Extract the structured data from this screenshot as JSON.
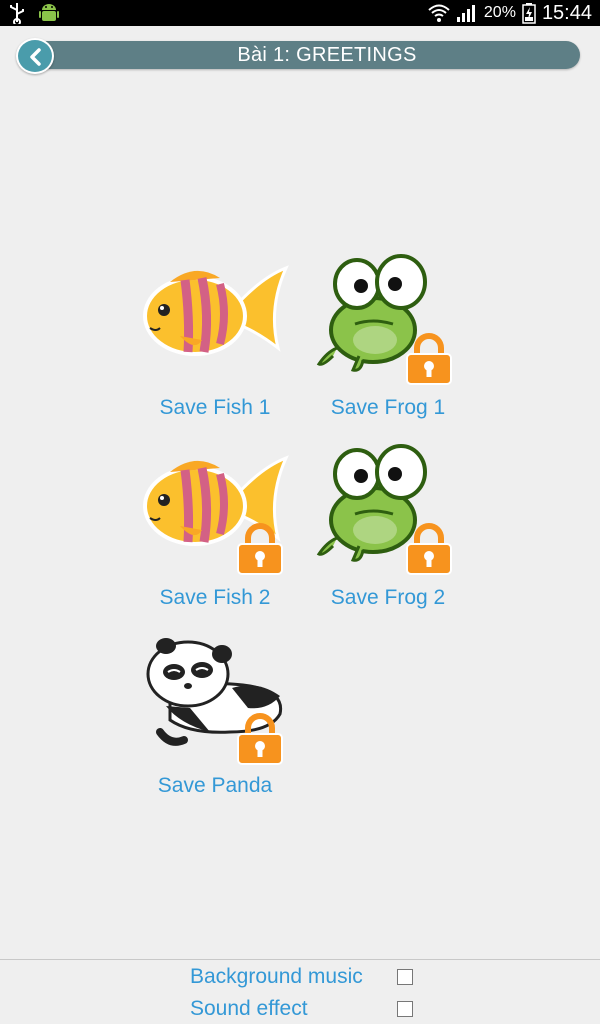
{
  "status_bar": {
    "icons_left": [
      "usb-icon",
      "android-icon"
    ],
    "icons_right": [
      "wifi-icon",
      "signal-icon",
      "battery-icon"
    ],
    "battery": "20%",
    "time": "15:44"
  },
  "header": {
    "title": "Bài 1: GREETINGS",
    "back_icon": "chevron-left-icon"
  },
  "items": [
    {
      "label": "Save Fish 1",
      "animal": "fish",
      "locked": false
    },
    {
      "label": "Save Frog 1",
      "animal": "frog",
      "locked": true
    },
    {
      "label": "Save Fish 2",
      "animal": "fish",
      "locked": true
    },
    {
      "label": "Save Frog 2",
      "animal": "frog",
      "locked": true
    },
    {
      "label": "Save Panda",
      "animal": "panda",
      "locked": true
    }
  ],
  "settings": [
    {
      "label": "Background music",
      "checked": false
    },
    {
      "label": "Sound effect",
      "checked": false
    }
  ],
  "colors": {
    "accent_text": "#3398d6",
    "title_bar": "#5e7f86",
    "back_button": "#4a9cab",
    "lock": "#f7931e"
  }
}
